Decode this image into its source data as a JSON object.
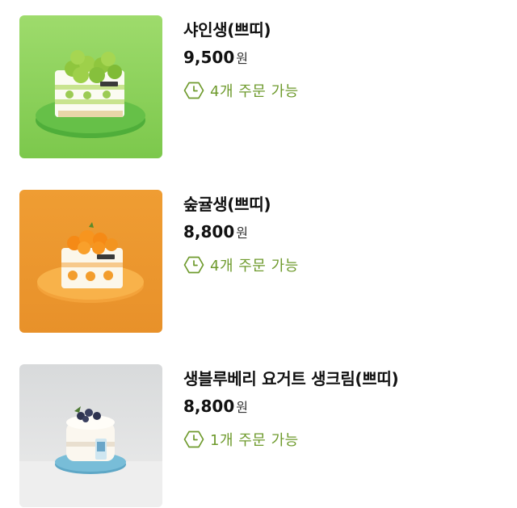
{
  "products": [
    {
      "name": "샤인생(쁘띠)",
      "price": "9,500",
      "price_unit": "원",
      "stock": "4개 주문 가능",
      "image_icon": "shine-muscat-cake-image"
    },
    {
      "name": "숲귤생(쁘띠)",
      "price": "8,800",
      "price_unit": "원",
      "stock": "4개 주문 가능",
      "image_icon": "tangerine-cake-image"
    },
    {
      "name": "생블루베리 요거트 생크림(쁘띠)",
      "price": "8,800",
      "price_unit": "원",
      "stock": "1개 주문 가능",
      "image_icon": "blueberry-yogurt-cake-image"
    }
  ],
  "colors": {
    "stock_text": "#6e9a2c",
    "thumb_green": "#8fd45f",
    "thumb_orange": "#eb9830",
    "thumb_grey": "#e2e4e4"
  }
}
